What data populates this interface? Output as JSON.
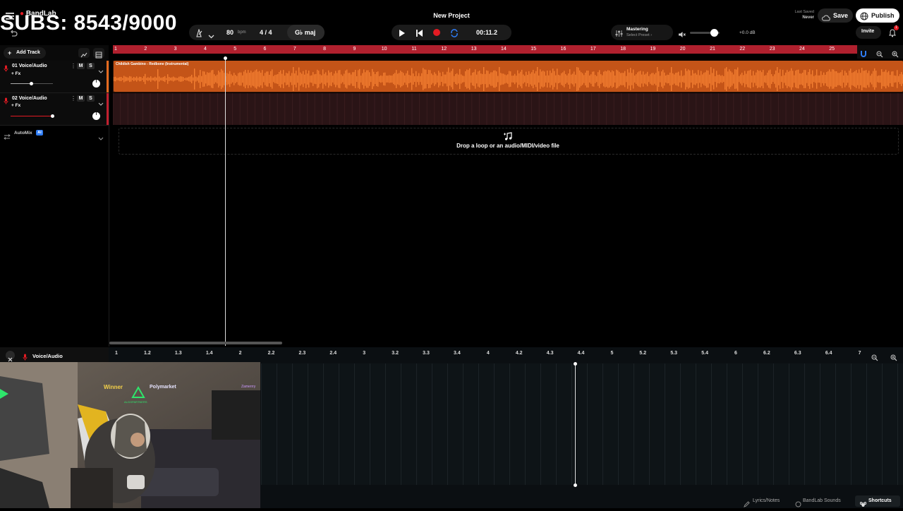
{
  "overlay": {
    "subs_text": "SUBS: 8543/9000"
  },
  "app": {
    "brand": "BandLab",
    "title": "New Project"
  },
  "header": {
    "tempo": "80",
    "tempo_unit": "bpm",
    "time_sig": "4 / 4",
    "key": "G♭ maj",
    "time": "00:11.2",
    "mastering_title": "Mastering",
    "mastering_sub": "Select Preset ›",
    "volume_db": "+0.0 dB",
    "last_saved_label": "Last Saved",
    "last_saved_value": "Never",
    "save": "Save",
    "publish": "Publish",
    "invite": "Invite",
    "notif_count": "1"
  },
  "sidebar": {
    "add_track": "Add Track"
  },
  "tracks": [
    {
      "name": "01  Voice/Audio",
      "fx": "+ Fx",
      "mute": "M",
      "solo": "S",
      "volume": 0.5
    },
    {
      "name": "02  Voice/Audio",
      "fx": "+ Fx",
      "mute": "M",
      "solo": "S",
      "volume": 0.85
    }
  ],
  "automix": {
    "label": "AutoMix",
    "badge": "AI"
  },
  "clip": {
    "name": "Childish Gambino - Redbone (Instrumental)"
  },
  "dropzone": {
    "text": "Drop a loop or an audio/MIDI/video file"
  },
  "ruler": {
    "numbers": [
      "1",
      "2",
      "3",
      "4",
      "5",
      "6",
      "7",
      "8",
      "9",
      "10",
      "11",
      "12",
      "13",
      "14",
      "15",
      "16",
      "17",
      "18",
      "19",
      "20",
      "21",
      "22",
      "23",
      "24",
      "25"
    ]
  },
  "editor": {
    "track_label": "Voice/Audio",
    "ruler": [
      "1",
      "1.2",
      "1.3",
      "1.4",
      "2",
      "2.2",
      "2.3",
      "2.4",
      "3",
      "3.2",
      "3.3",
      "3.4",
      "4",
      "4.2",
      "4.3",
      "4.4",
      "5",
      "5.2",
      "5.3",
      "5.4",
      "6",
      "6.2",
      "6.3",
      "6.4",
      "7"
    ]
  },
  "footer": {
    "lyrics": "Lyrics/Notes",
    "sounds": "BandLab Sounds",
    "shortcuts": "Shortcuts"
  },
  "webcam": {
    "sign1": "Winner",
    "sign2": "Polymarket",
    "sign3": "ALGOPARTNERS",
    "sign4": "Zamerrry"
  },
  "colors": {
    "accent_red": "#c2202f",
    "clip_orange": "#e46a1f",
    "record_red": "#e31b23",
    "loop_blue": "#2f7df6"
  }
}
